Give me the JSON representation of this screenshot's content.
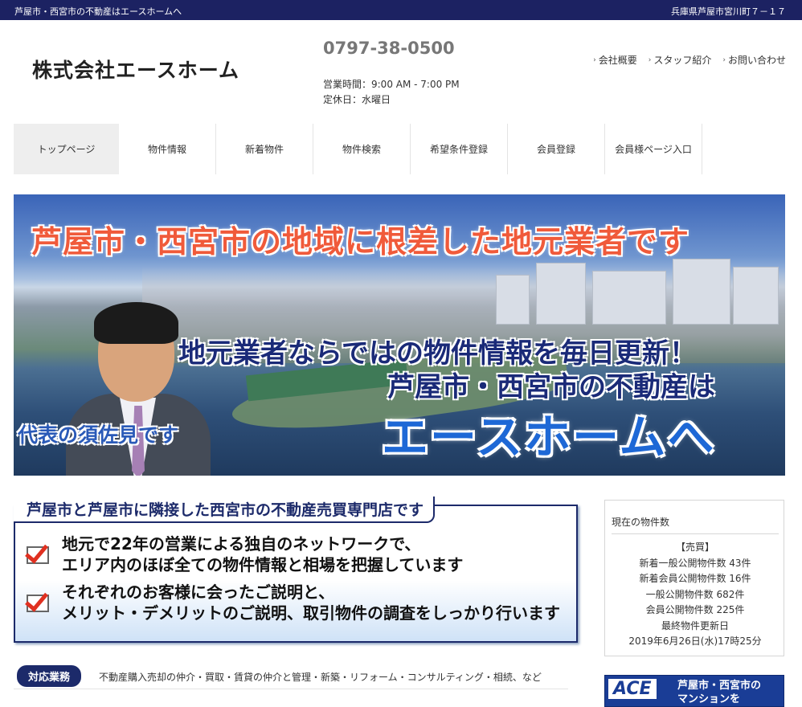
{
  "topbar": {
    "left": "芦屋市・西宮市の不動産はエースホームへ",
    "right": "兵庫県芦屋市宮川町７－１７"
  },
  "header": {
    "logo": "株式会社エースホーム",
    "phone": "0797-38-0500",
    "hours": "営業時間：9:00 AM - 7:00 PM",
    "holiday": "定休日：水曜日",
    "links": [
      "会社概要",
      "スタッフ紹介",
      "お問い合わせ"
    ]
  },
  "nav": {
    "items": [
      "トップページ",
      "物件情報",
      "新着物件",
      "物件検索",
      "希望条件登録",
      "会員登録",
      "会員様ページ入口"
    ]
  },
  "hero": {
    "headline": "芦屋市・西宮市の地域に根差した地元業者です",
    "line2": "地元業者ならではの物件情報を毎日更新！",
    "line3": "芦屋市・西宮市の不動産は",
    "line4": "エースホームへ",
    "caption": "代表の須佐見です"
  },
  "feature": {
    "title": "芦屋市と芦屋市に隣接した西宮市の不動産売買専門店です",
    "items": [
      {
        "l1": "地元で22年の営業による独自のネットワークで、",
        "l2": "エリア内のほぼ全ての物件情報と相場を把握しています"
      },
      {
        "l1": "それぞれのお客様に会ったご説明と、",
        "l2": "メリット・デメリットのご説明、取引物件の調査をしっかり行います"
      }
    ]
  },
  "service": {
    "badge": "対応業務",
    "desc": "不動産購入売却の仲介・買取・賃貸の仲介と管理・新築・リフォーム・コンサルティング・相続、など"
  },
  "sidebar": {
    "title": "現在の物件数",
    "lines": [
      "【売買】",
      "新着一般公開物件数 43件",
      "新着会員公開物件数 16件",
      "一般公開物件数 682件",
      "会員公開物件数 225件",
      "最終物件更新日",
      "2019年6月26日(水)17時25分"
    ]
  },
  "banner": {
    "logo": "ACE",
    "text1": "芦屋市・西宮市の",
    "text2": "マンションを"
  },
  "colors": {
    "navy": "#1c2262",
    "accent_red": "#f05a3a",
    "accent_blue": "#1e68d6"
  }
}
